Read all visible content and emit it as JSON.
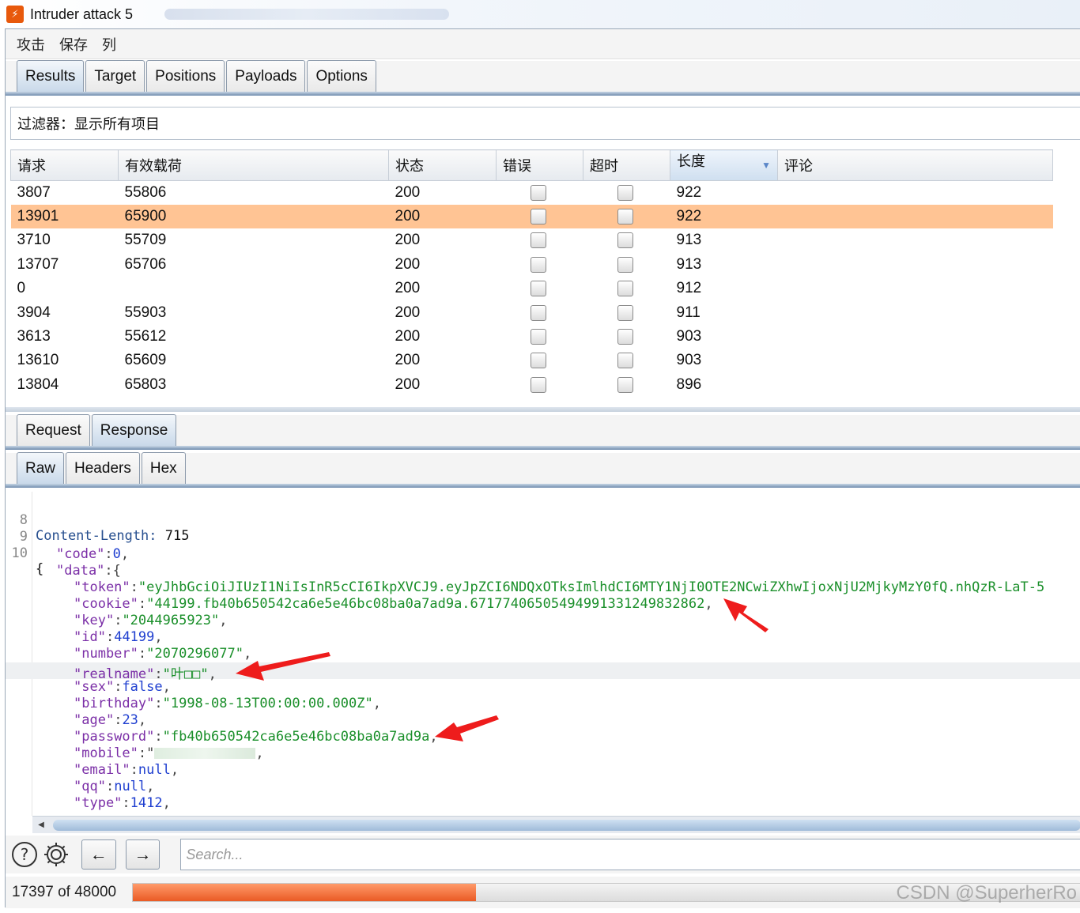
{
  "window": {
    "title": "Intruder attack 5"
  },
  "menu": [
    "攻击",
    "保存",
    "列"
  ],
  "tabs": {
    "items": [
      "Results",
      "Target",
      "Positions",
      "Payloads",
      "Options"
    ],
    "active": "Results"
  },
  "filter": {
    "label": "过滤器：",
    "value": "显示所有项目"
  },
  "table": {
    "columns": [
      "请求",
      "有效载荷",
      "状态",
      "错误",
      "超时",
      "长度",
      "评论"
    ],
    "sorted_column": "长度",
    "selected_row": 1,
    "rows": [
      {
        "request": "3807",
        "payload": "55806",
        "status": "200",
        "length": "922"
      },
      {
        "request": "13901",
        "payload": "65900",
        "status": "200",
        "length": "922"
      },
      {
        "request": "3710",
        "payload": "55709",
        "status": "200",
        "length": "913"
      },
      {
        "request": "13707",
        "payload": "65706",
        "status": "200",
        "length": "913"
      },
      {
        "request": "0",
        "payload": "",
        "status": "200",
        "length": "912"
      },
      {
        "request": "3904",
        "payload": "55903",
        "status": "200",
        "length": "911"
      },
      {
        "request": "3613",
        "payload": "55612",
        "status": "200",
        "length": "903"
      },
      {
        "request": "13610",
        "payload": "65609",
        "status": "200",
        "length": "903"
      },
      {
        "request": "13804",
        "payload": "65803",
        "status": "200",
        "length": "896"
      }
    ]
  },
  "detail_tabs": {
    "items": [
      "Request",
      "Response"
    ],
    "active": "Response"
  },
  "view_tabs": {
    "items": [
      "Raw",
      "Headers",
      "Hex"
    ],
    "active": "Raw"
  },
  "response": {
    "content_length_header": "Content-Length:",
    "content_length_value": "715",
    "lines": [
      {
        "num": "8",
        "text": "Content-Length: 715"
      },
      {
        "num": "9",
        "text": ""
      },
      {
        "num": "10",
        "text": "{"
      }
    ],
    "json": {
      "code": "0",
      "token": "\"eyJhbGciOiJIUzI1NiIsInR5cCI6IkpXVCJ9.eyJpZCI6NDQxOTksImlhdCI6MTY1NjI0OTE2NCwiZXhwIjoxNjU2MjkyMzY0fQ.nhQzR-LaT-5",
      "cookie": "\"44199.fb40b650542ca6e5e46bc08ba0a7ad9a.67177406505494991331249832862",
      "key": "\"2044965923\"",
      "id": "44199",
      "number": "\"2070296077\"",
      "realname": "\"叶□□\"",
      "sex": "false",
      "birthday": "\"1998-08-13T00:00:00.000Z\"",
      "age": "23",
      "password": "\"fb40b650542ca6e5e46bc08ba0a7ad9a",
      "email": "null",
      "qq": "null",
      "type": "1412"
    }
  },
  "search": {
    "placeholder": "Search..."
  },
  "status": {
    "text": "17397 of 48000",
    "progress_fraction": 0.3624
  },
  "watermark": "CSDN @SuperherRo",
  "colors": {
    "selected_row": "#ffc494",
    "progress": "#ea5a24",
    "annotation_arrow": "#ee1c1c"
  }
}
